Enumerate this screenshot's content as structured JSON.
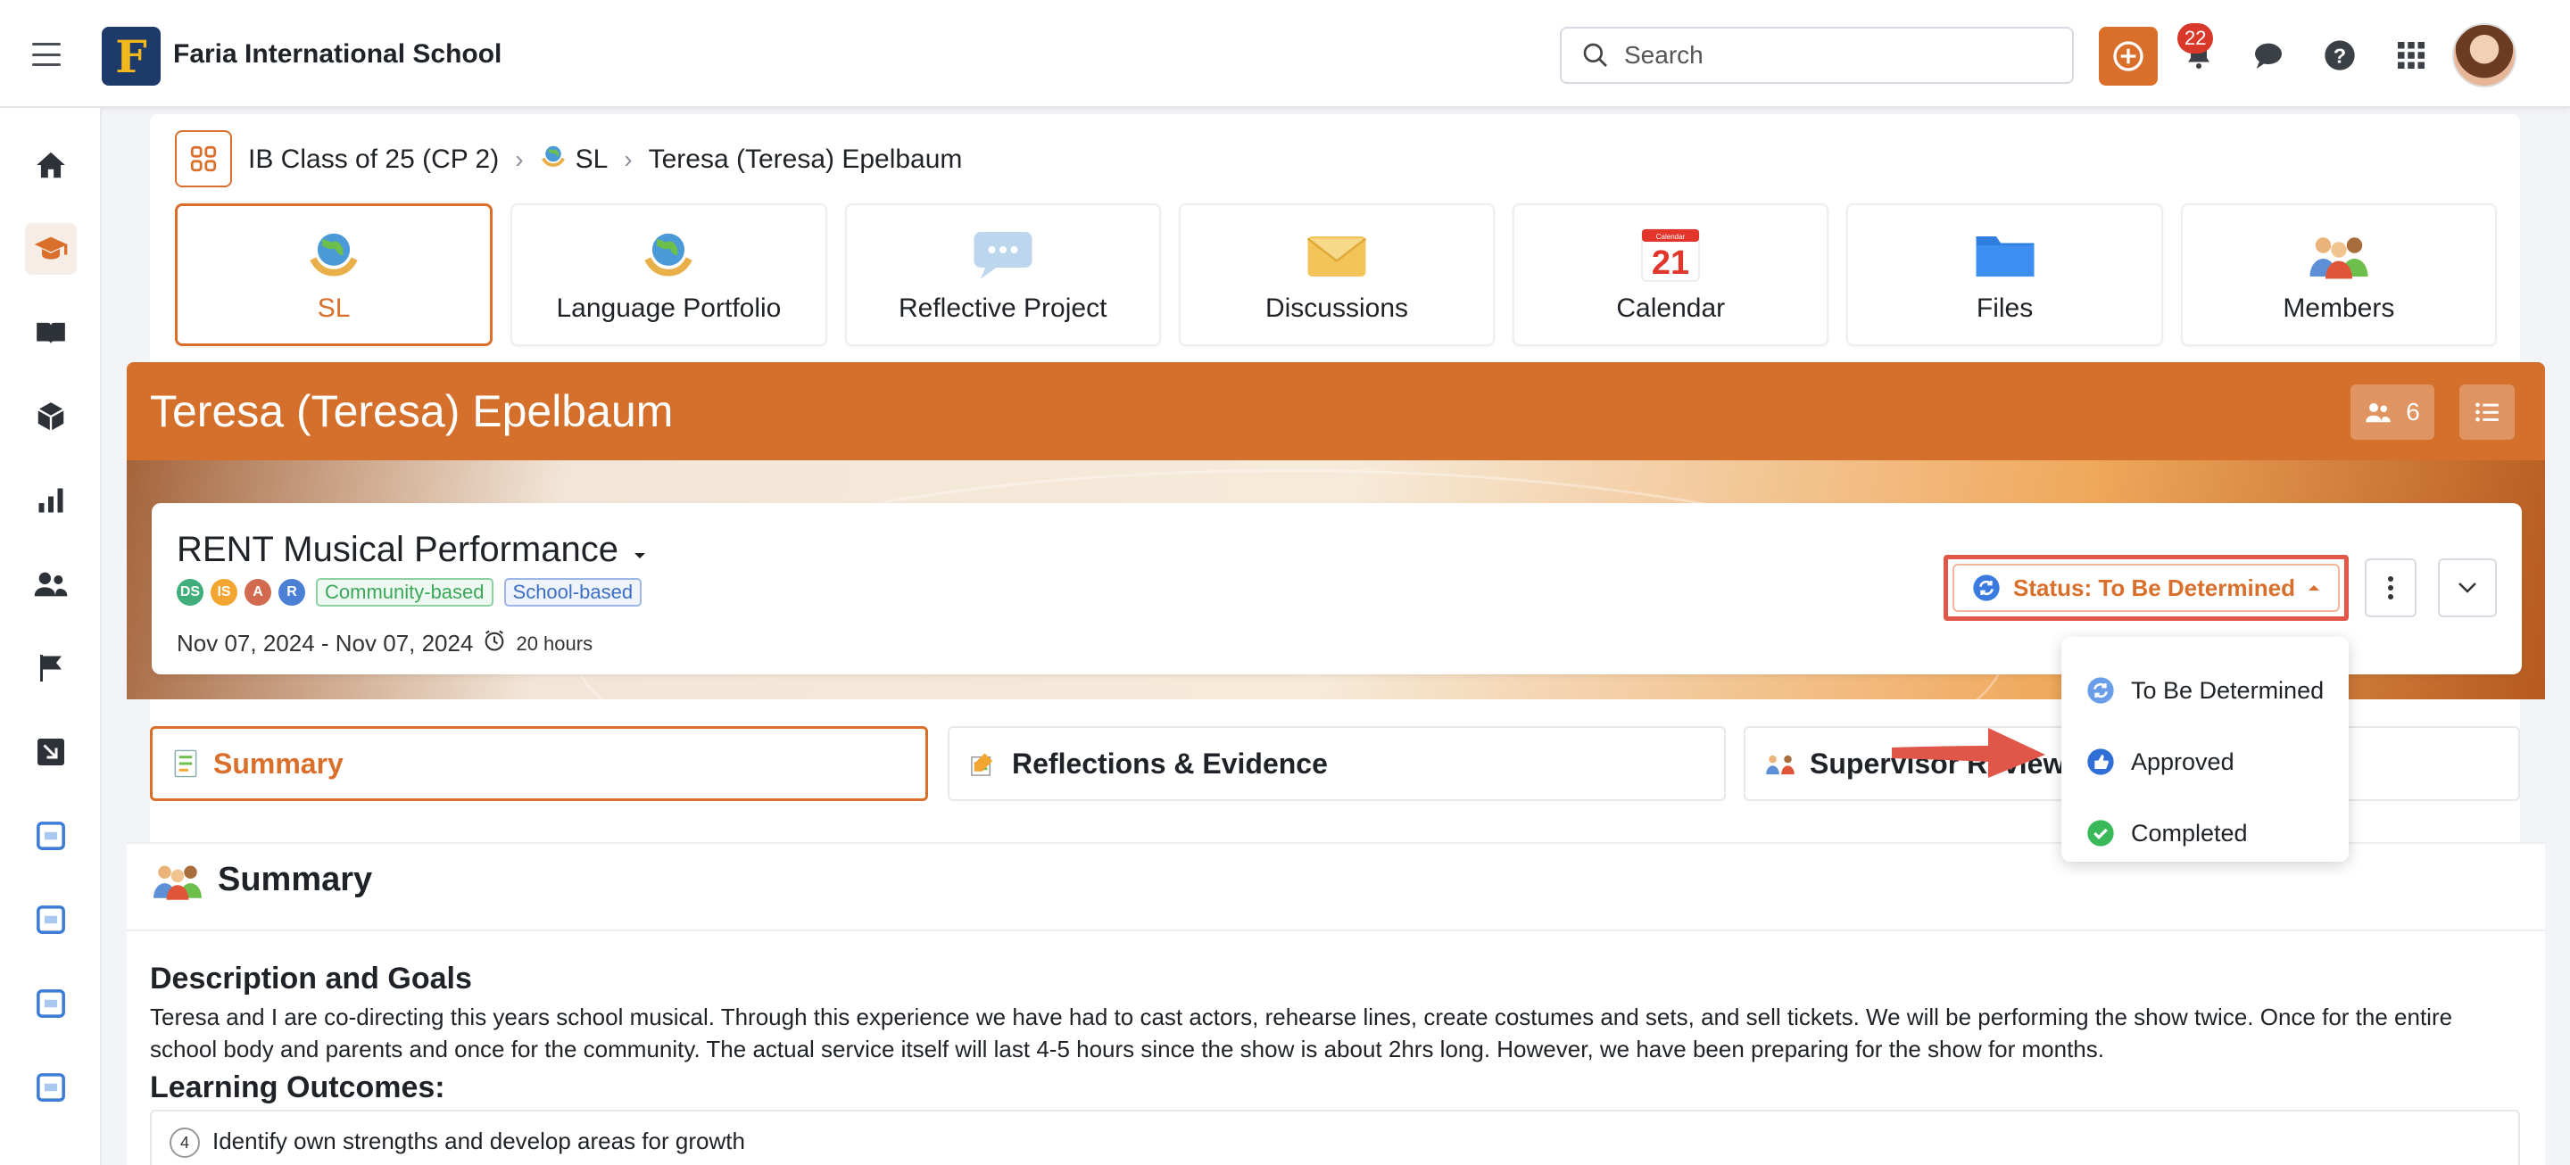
{
  "app": {
    "school_name": "Faria International School",
    "logo_letter": "F",
    "search_placeholder": "Search",
    "notification_count": "22"
  },
  "breadcrumb": {
    "class_name": "IB Class of 25 (CP 2)",
    "course": "SL",
    "student": "Teresa (Teresa) Epelbaum"
  },
  "tabs": [
    {
      "label": "SL",
      "icon": "globe-hands-icon"
    },
    {
      "label": "Language Portfolio",
      "icon": "globe-hands-icon"
    },
    {
      "label": "Reflective Project",
      "icon": "speech-bubble-icon"
    },
    {
      "label": "Discussions",
      "icon": "envelope-icon"
    },
    {
      "label": "Calendar",
      "icon": "calendar-icon"
    },
    {
      "label": "Files",
      "icon": "folder-icon"
    },
    {
      "label": "Members",
      "icon": "people-icon"
    }
  ],
  "calendar_day": "21",
  "calendar_top": "Calendar",
  "header": {
    "title": "Teresa (Teresa) Epelbaum",
    "member_count": "6"
  },
  "activity": {
    "title": "RENT Musical Performance",
    "initials": [
      "DS",
      "IS",
      "A",
      "R"
    ],
    "tags": [
      "Community-based",
      "School-based"
    ],
    "date_range": "Nov 07, 2024 - Nov 07, 2024",
    "hours": "20 hours",
    "status_label": "Status: To Be Determined"
  },
  "status_options": [
    {
      "label": "To Be Determined",
      "icon": "refresh-icon",
      "color": "#3b7be0"
    },
    {
      "label": "Approved",
      "icon": "thumbs-up-icon",
      "color": "#2f6fd6"
    },
    {
      "label": "Completed",
      "icon": "check-circle-icon",
      "color": "#3ab95a"
    }
  ],
  "section_tabs": [
    {
      "label": "Summary"
    },
    {
      "label": "Reflections & Evidence"
    },
    {
      "label": "Supervisor Review"
    }
  ],
  "summary": {
    "heading": "Summary",
    "description_heading": "Description and Goals",
    "description": "Teresa and I are co-directing this years school musical. Through this experience we have had to cast actors, rehearse lines, create costumes and sets, and sell tickets. We will be performing the show twice. Once for the entire school body and parents and once for the community. The actual service itself will last 4-5 hours since the show is about 2hrs long. However, we have been preparing for the show for months.",
    "outcomes_heading": "Learning Outcomes:",
    "outcomes": [
      {
        "number": "4",
        "text": "Identify own strengths and develop areas for growth"
      }
    ]
  },
  "colors": {
    "accent": "#d96f2a",
    "header": "#d4702c",
    "highlight_box": "#e05647"
  }
}
